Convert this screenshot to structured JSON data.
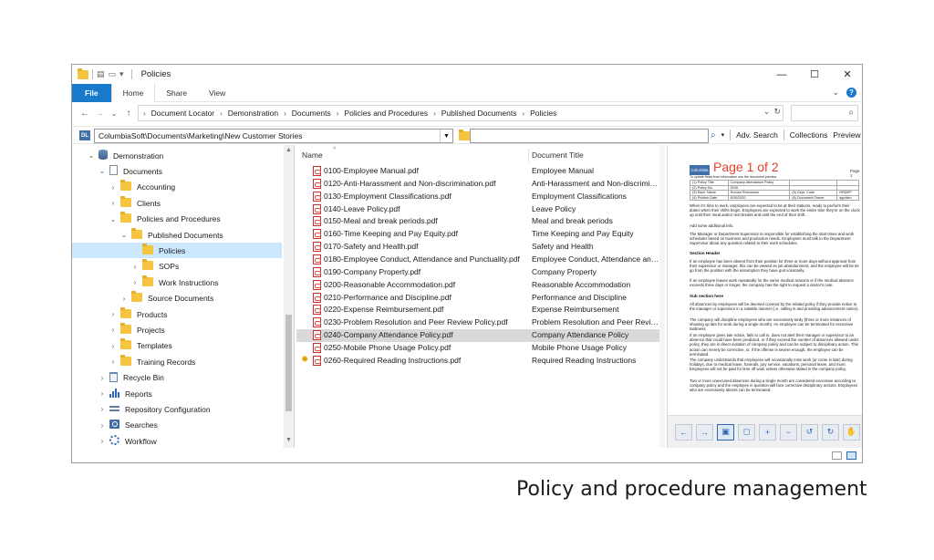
{
  "window": {
    "title": "Policies",
    "controls": {
      "minimize": "—",
      "maximize": "☐",
      "close": "✕"
    }
  },
  "ribbon": {
    "tabs": [
      "File",
      "Home",
      "Share",
      "View"
    ],
    "expand": "⌄",
    "help": "?"
  },
  "address": {
    "back": "←",
    "forward": "→",
    "recent": "⌄",
    "up": "↑",
    "crumbs": [
      "Document Locator",
      "Demonstration",
      "Documents",
      "Policies and Procedures",
      "Published Documents",
      "Policies"
    ],
    "dropdown": "⌄",
    "refresh": "↻",
    "search_placeholder": ""
  },
  "toolbar": {
    "logo": "DL",
    "path": "ColumbiaSoft\\Documents\\Marketing\\New Customer Stories",
    "search_value": "",
    "links": [
      "Adv. Search",
      "Collections",
      "Preview"
    ]
  },
  "tree": [
    {
      "label": "Demonstration",
      "arrow": "⌄",
      "icon": "database-icon",
      "level": 0
    },
    {
      "label": "Documents",
      "arrow": "⌄",
      "icon": "document-icon",
      "level": 1
    },
    {
      "label": "Accounting",
      "arrow": "›",
      "icon": "folder-icon",
      "level": 2
    },
    {
      "label": "Clients",
      "arrow": "›",
      "icon": "folder-icon",
      "level": 2
    },
    {
      "label": "Policies and Procedures",
      "arrow": "⌄",
      "icon": "folder-icon",
      "level": 2
    },
    {
      "label": "Published Documents",
      "arrow": "⌄",
      "icon": "folder-icon",
      "level": 3
    },
    {
      "label": "Policies",
      "arrow": "",
      "icon": "folder-icon",
      "level": 4,
      "selected": true
    },
    {
      "label": "SOPs",
      "arrow": "›",
      "icon": "folder-icon",
      "level": 4
    },
    {
      "label": "Work Instructions",
      "arrow": "›",
      "icon": "folder-icon",
      "level": 4
    },
    {
      "label": "Source Documents",
      "arrow": "›",
      "icon": "folder-icon",
      "level": 3
    },
    {
      "label": "Products",
      "arrow": "›",
      "icon": "folder-icon",
      "level": 2
    },
    {
      "label": "Projects",
      "arrow": "›",
      "icon": "folder-icon",
      "level": 2
    },
    {
      "label": "Templates",
      "arrow": "›",
      "icon": "folder-icon",
      "level": 2
    },
    {
      "label": "Training Records",
      "arrow": "›",
      "icon": "folder-icon",
      "level": 2
    },
    {
      "label": "Recycle Bin",
      "arrow": "›",
      "icon": "recycle-bin-icon",
      "level": 1
    },
    {
      "label": "Reports",
      "arrow": "›",
      "icon": "reports-icon",
      "level": 1
    },
    {
      "label": "Repository Configuration",
      "arrow": "›",
      "icon": "configuration-icon",
      "level": 1
    },
    {
      "label": "Searches",
      "arrow": "›",
      "icon": "searches-icon",
      "level": 1
    },
    {
      "label": "Workflow",
      "arrow": "›",
      "icon": "workflow-icon",
      "level": 1
    }
  ],
  "files": {
    "columns": {
      "name": "Name",
      "sort": "^",
      "title": "Document Title"
    },
    "rows": [
      {
        "name": "0100-Employee Manual.pdf",
        "title": "Employee Manual"
      },
      {
        "name": "0120-Anti-Harassment and Non-discrimination.pdf",
        "title": "Anti-Harassment and Non-discrimin..."
      },
      {
        "name": "0130-Employment Classifications.pdf",
        "title": "Employment Classifications"
      },
      {
        "name": "0140-Leave Policy.pdf",
        "title": "Leave Policy"
      },
      {
        "name": "0150-Meal and break periods.pdf",
        "title": "Meal and break periods"
      },
      {
        "name": "0160-Time Keeping and Pay Equity.pdf",
        "title": "Time Keeping and Pay Equity"
      },
      {
        "name": "0170-Safety and Health.pdf",
        "title": "Safety and Health"
      },
      {
        "name": "0180-Employee Conduct, Attendance and Punctuality.pdf",
        "title": "Employee Conduct, Attendance and ..."
      },
      {
        "name": "0190-Company Property.pdf",
        "title": "Company Property"
      },
      {
        "name": "0200-Reasonable Accommodation.pdf",
        "title": "Reasonable Accommodation"
      },
      {
        "name": "0210-Performance and Discipline.pdf",
        "title": "Performance and Discipline"
      },
      {
        "name": "0220-Expense Reimbursement.pdf",
        "title": "Expense Reimbursement"
      },
      {
        "name": "0230-Problem Resolution and Peer Review Policy.pdf",
        "title": "Problem Resolution and Peer Review"
      },
      {
        "name": "0240-Company Attendance Policy.pdf",
        "title": "Company Attendance Policy",
        "selected": true
      },
      {
        "name": "0250-Mobile Phone Usage Policy.pdf",
        "title": "Mobile Phone Usage Policy"
      },
      {
        "name": "0260-Required Reading Instructions.pdf",
        "title": "Required Reading Instructions",
        "flag": true
      }
    ]
  },
  "preview": {
    "logo": "Columbia",
    "page_counter": "Page 1 of 2",
    "page_label": "Page 1",
    "note": "To update fields from information use the document preview",
    "table": [
      [
        "(1) Policy Title",
        "Company Attendance Policy",
        "",
        ""
      ],
      [
        "(2) Policy No.",
        "0240",
        "",
        ""
      ],
      [
        "(3) Dept. Name",
        "Human Resources",
        "(5) Dept. Code",
        "HRDEP"
      ],
      [
        "(4) Publish Date",
        "6/30/2020",
        "(6) Document Owner",
        "sgohlen"
      ]
    ],
    "para1": "When it's time to work, employees are expected to be at their stations, ready to perform their duties when their shifts begin. Employees are expected to work the entire time they're on the clock up until their meal and/or rest breaks and until the end of their shift.",
    "para2": "Add some additional info.",
    "para3": "The Manager or Department Supervisor is responsible for establishing the start times and work schedules based on business and production needs. Employees must talk to the Department Supervisor about any question related to their work schedules.",
    "head1": "Section Header",
    "para4": "If an employee has been absent from their position for three or more days without approval from their supervisor or manager, this can be viewed as job abandonment, and the employee will be let go from the position with the assumption they have quit voluntarily.",
    "para5": "If an employee leaves work repeatedly for the same medical reasons or if the medical absence exceeds three days or longer, the company has the right to request a doctor's note.",
    "head2": "Sub section here",
    "para6": "All absences by employees will be deemed covered by the related policy if they provide notice to the manager or supervisor in a suitable manner (i.e. calling in and providing advancement notice).",
    "para7": "The company will discipline employees who are excessively tardy (three or more instances of showing up late for work during a single month). An employee can be terminated for excessive tardiness.",
    "para8": "If an employee gives late notice, fails to call in, does not alert their manager or supervisor to an absence that could have been predicted, or if they exceed the number of absences allowed under policy, they are in direct violation of company policy and can be subject to disciplinary action. This action can merely be corrective, or, if the offense is severe enough, the employee can be terminated.",
    "para9": "The company understands that employees will occasionally miss work (or come in late) during holidays, due to medical leave, funerals, jury service, vacations, personal leave, and more. Employees will not be paid for time off work unless otherwise stated in the company policy.",
    "para10": "Two or more unexcused absences during a single month are considered excessive according to company policy and the employee in question will face corrective disciplinary actions. Employees who are excessively absent can be terminated.",
    "tools": [
      "←",
      "→",
      "▣",
      "◻",
      "+",
      "−",
      "↺",
      "↻",
      "✋"
    ]
  },
  "caption": "Policy and procedure management",
  "colors": {
    "accent": "#1979ca",
    "selection": "#cce8ff",
    "folder": "#f5c542",
    "page_counter": "#e8402a"
  }
}
